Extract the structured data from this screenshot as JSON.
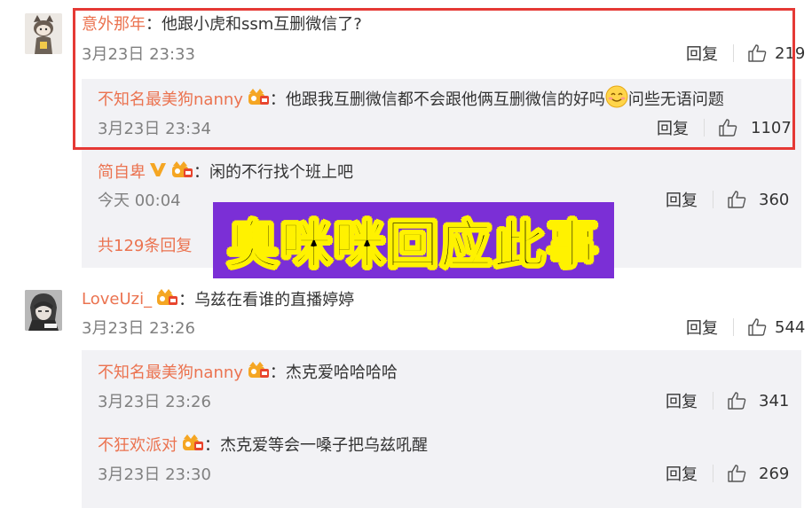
{
  "overlay_caption": "奥咪咪回应此事",
  "comments": [
    {
      "name": "意外那年",
      "text": "：他跟小虎和ssm互删微信了?",
      "time": "3月23日 23:33",
      "reply_label": "回复",
      "likes": "219",
      "avatar_icon": "cat-avatar-icon"
    },
    {
      "name": "LoveUzi_",
      "text": "：乌兹在看谁的直播婷婷",
      "time": "3月23日 23:26",
      "reply_label": "回复",
      "likes": "544",
      "avatar_icon": "anime-avatar-icon"
    }
  ],
  "replies_group1": [
    {
      "name": "不知名最美狗nanny",
      "text_a": "：他跟我互删微信都不会跟他俩互删微信的好吗",
      "text_b": "问些无语问题",
      "time": "3月23日 23:34",
      "reply_label": "回复",
      "likes": "1107"
    },
    {
      "name": "简自卑",
      "text": "：闲的不行找个班上吧",
      "time": "今天 00:04",
      "reply_label": "回复",
      "likes": "360"
    }
  ],
  "more_replies": "共129条回复",
  "replies_group2": [
    {
      "name": "不知名最美狗nanny",
      "text": "：杰克爱哈哈哈哈",
      "time": "3月23日 23:26",
      "reply_label": "回复",
      "likes": "341"
    },
    {
      "name": "不狂欢派对",
      "text": "：杰克爱等会一嗓子把乌兹吼醒",
      "time": "3月23日 23:30",
      "reply_label": "回复",
      "likes": "269"
    }
  ],
  "colors": {
    "name": "#eb7350",
    "highlight_box": "#e53935",
    "overlay_bg": "#7b2fd6",
    "overlay_text_stroke": "#fff200"
  }
}
